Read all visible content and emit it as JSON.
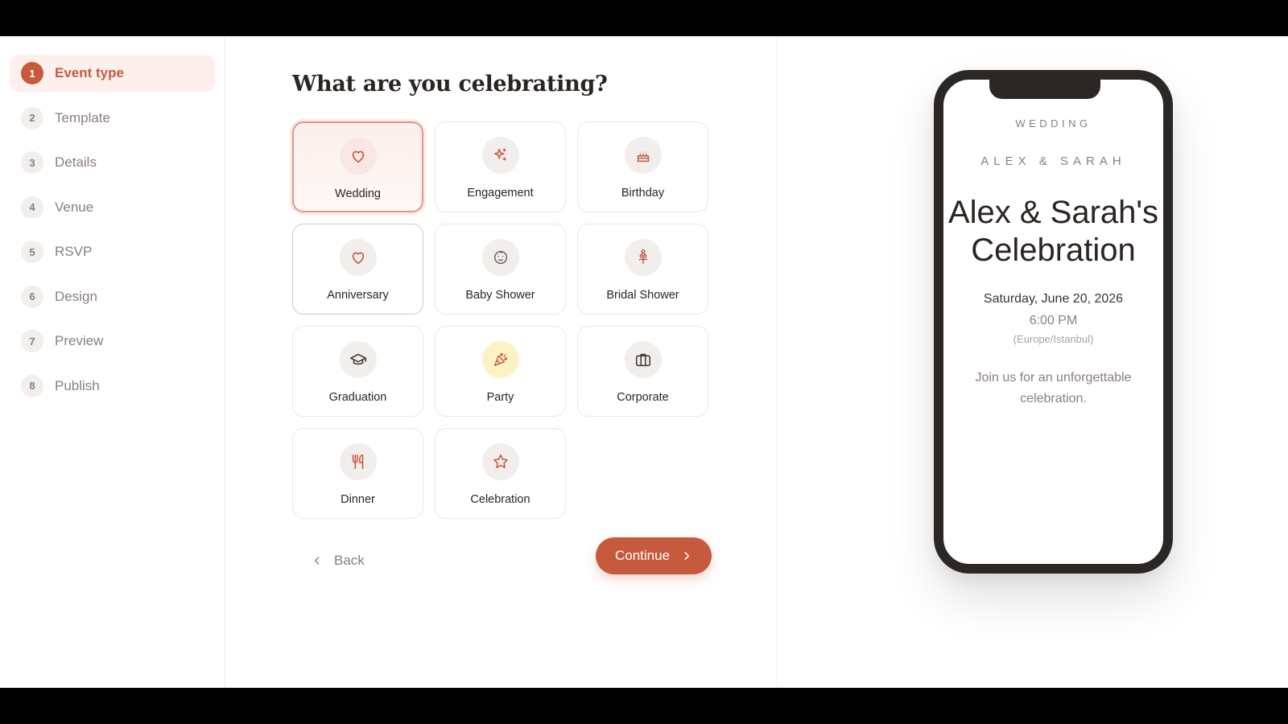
{
  "steps": [
    {
      "num": "1",
      "label": "Event type"
    },
    {
      "num": "2",
      "label": "Template"
    },
    {
      "num": "3",
      "label": "Details"
    },
    {
      "num": "4",
      "label": "Venue"
    },
    {
      "num": "5",
      "label": "RSVP"
    },
    {
      "num": "6",
      "label": "Design"
    },
    {
      "num": "7",
      "label": "Preview"
    },
    {
      "num": "8",
      "label": "Publish"
    }
  ],
  "main": {
    "title": "What are you celebrating?",
    "event_types": [
      {
        "label": "Wedding",
        "icon": "heart-icon"
      },
      {
        "label": "Engagement",
        "icon": "sparkles-icon"
      },
      {
        "label": "Birthday",
        "icon": "cake-icon"
      },
      {
        "label": "Anniversary",
        "icon": "heart-icon"
      },
      {
        "label": "Baby Shower",
        "icon": "baby-icon"
      },
      {
        "label": "Bridal Shower",
        "icon": "flower-icon"
      },
      {
        "label": "Graduation",
        "icon": "graduation-cap-icon"
      },
      {
        "label": "Party",
        "icon": "party-popper-icon"
      },
      {
        "label": "Corporate",
        "icon": "briefcase-icon"
      },
      {
        "label": "Dinner",
        "icon": "utensils-icon"
      },
      {
        "label": "Celebration",
        "icon": "star-icon"
      }
    ],
    "selected": "Wedding",
    "back_label": "Back",
    "continue_label": "Continue"
  },
  "preview": {
    "event_type": "WEDDING",
    "names": "ALEX & SARAH",
    "title": "Alex & Sarah's Celebration",
    "date": "Saturday, June 20, 2026",
    "time": "6:00 PM",
    "timezone": "(Europe/Istanbul)",
    "message": "Join us for an unforgettable celebration."
  },
  "colors": {
    "accent": "#c75a3d",
    "accent_light": "#fdf0ec",
    "text": "#2b2522",
    "muted": "#8a7f7a",
    "phone_frame": "#2b2725"
  }
}
